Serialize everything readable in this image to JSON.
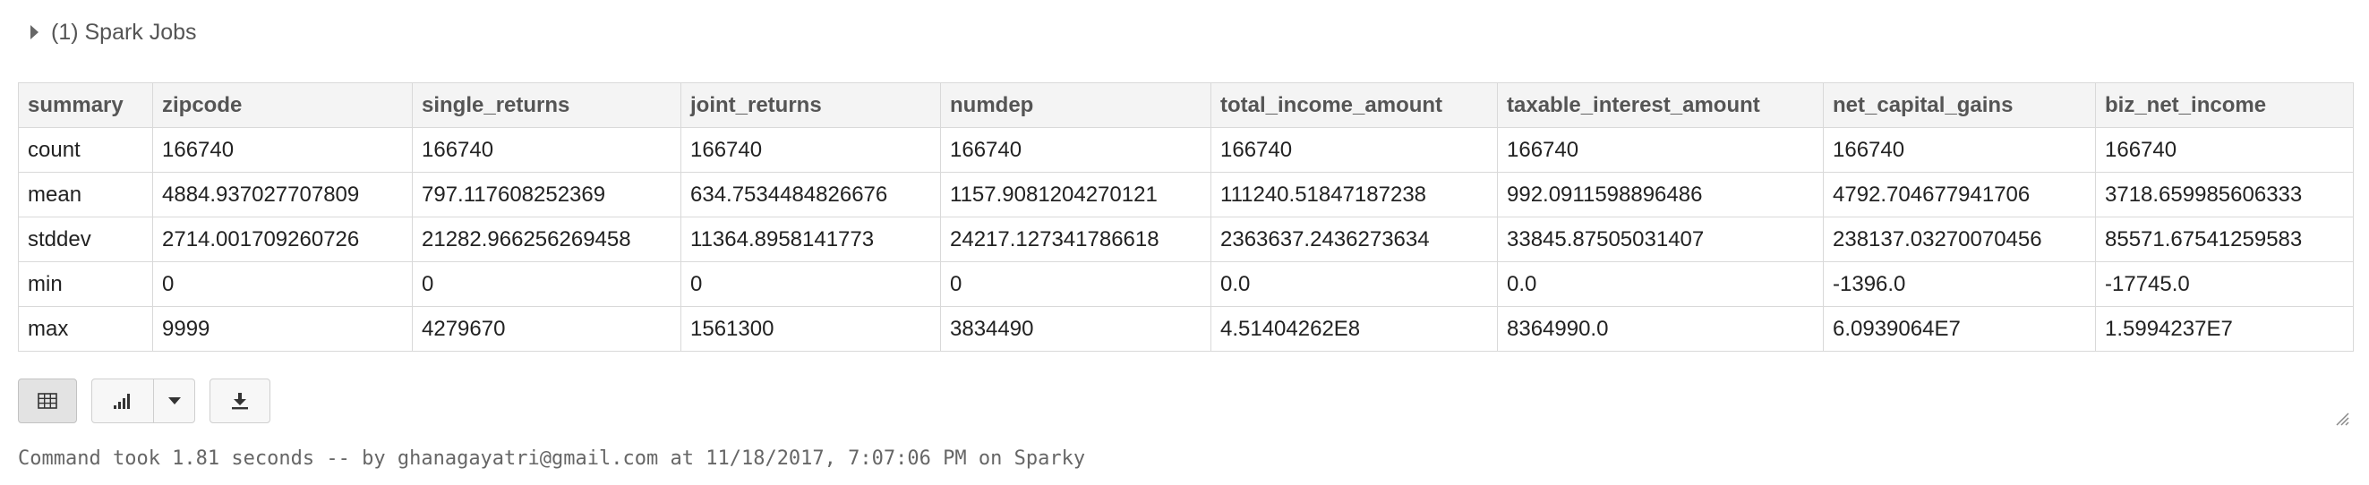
{
  "spark_jobs": {
    "label": "(1) Spark Jobs"
  },
  "table": {
    "columns": [
      "summary",
      "zipcode",
      "single_returns",
      "joint_returns",
      "numdep",
      "total_income_amount",
      "taxable_interest_amount",
      "net_capital_gains",
      "biz_net_income"
    ],
    "rows": [
      [
        "count",
        "166740",
        "166740",
        "166740",
        "166740",
        "166740",
        "166740",
        "166740",
        "166740"
      ],
      [
        "mean",
        "4884.937027707809",
        "797.117608252369",
        "634.7534484826676",
        "1157.9081204270121",
        "111240.51847187238",
        "992.0911598896486",
        "4792.704677941706",
        "3718.659985606333"
      ],
      [
        "stddev",
        "2714.001709260726",
        "21282.966256269458",
        "11364.8958141773",
        "24217.127341786618",
        "2363637.2436273634",
        "33845.87505031407",
        "238137.03270070456",
        "85571.67541259583"
      ],
      [
        "min",
        "0",
        "0",
        "0",
        "0",
        "0.0",
        "0.0",
        "-1396.0",
        "-17745.0"
      ],
      [
        "max",
        "9999",
        "4279670",
        "1561300",
        "3834490",
        "4.51404262E8",
        "8364990.0",
        "6.0939064E7",
        "1.5994237E7"
      ]
    ]
  },
  "toolbar": {
    "table_icon": "table-icon",
    "chart_icon": "bar-chart-icon",
    "dropdown_icon": "caret-down-icon",
    "download_icon": "download-icon"
  },
  "footer": {
    "text": "Command took 1.81 seconds -- by ghanagayatri@gmail.com at 11/18/2017, 7:07:06 PM on Sparky"
  }
}
